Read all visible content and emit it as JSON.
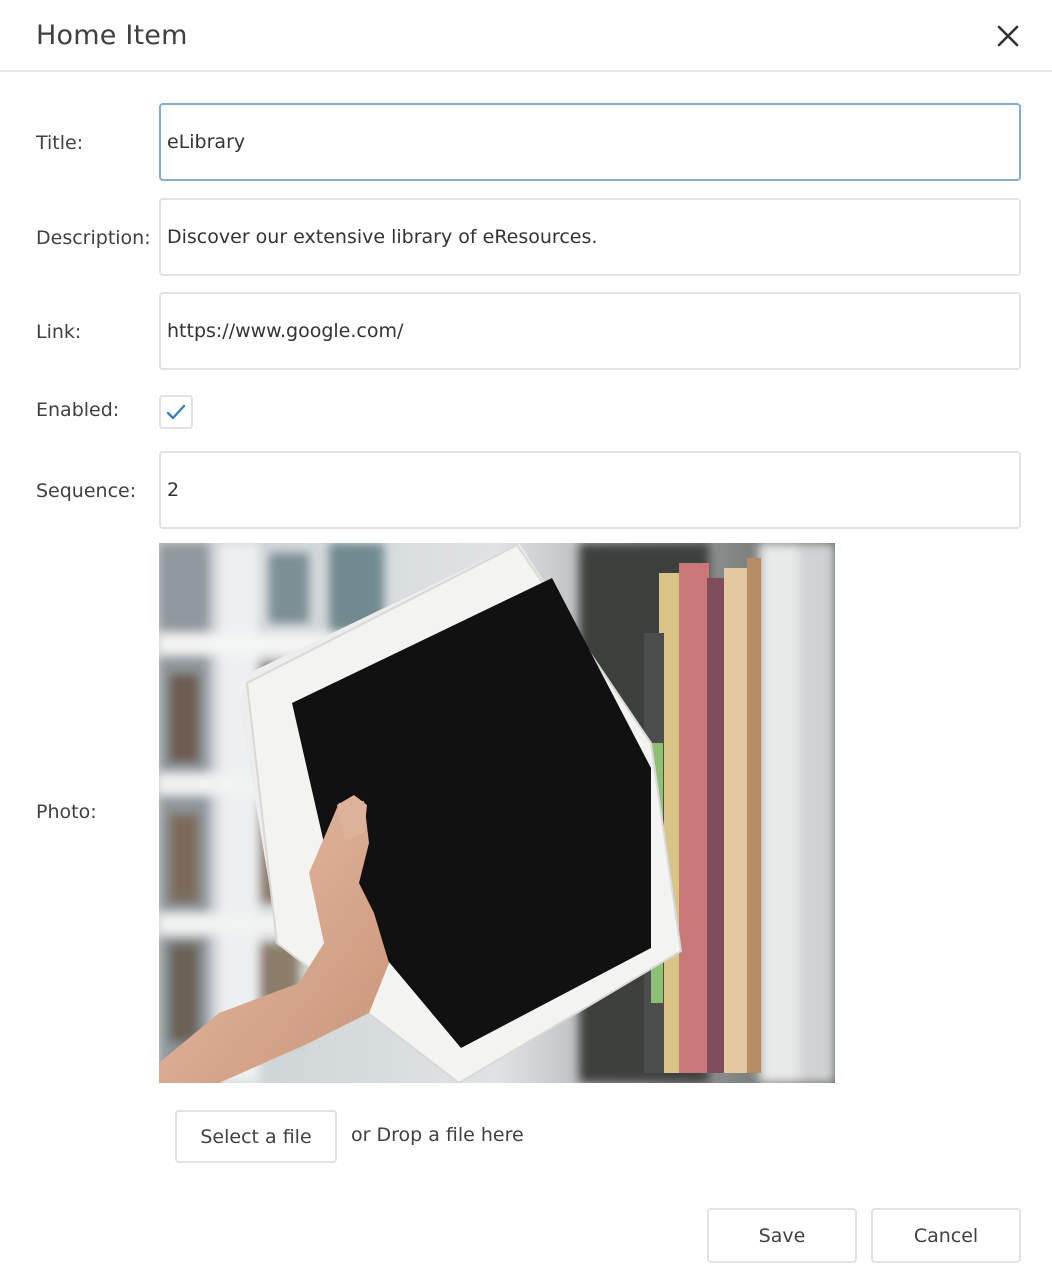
{
  "dialog": {
    "title": "Home Item",
    "close_icon": "close-icon"
  },
  "form": {
    "title_label": "Title:",
    "title_value": "eLibrary",
    "description_label": "Description:",
    "description_value": "Discover our extensive library of eResources.",
    "link_label": "Link:",
    "link_value": "https://www.google.com/",
    "enabled_label": "Enabled:",
    "enabled_checked": true,
    "sequence_label": "Sequence:",
    "sequence_value": "2",
    "photo_label": "Photo:"
  },
  "upload": {
    "select_label": "Select a file",
    "drop_text": "or Drop a file here"
  },
  "footer": {
    "save_label": "Save",
    "cancel_label": "Cancel"
  },
  "colors": {
    "focus_border": "#86acd3",
    "check_mark": "#3a7ec4",
    "border": "#e2e2e2"
  }
}
